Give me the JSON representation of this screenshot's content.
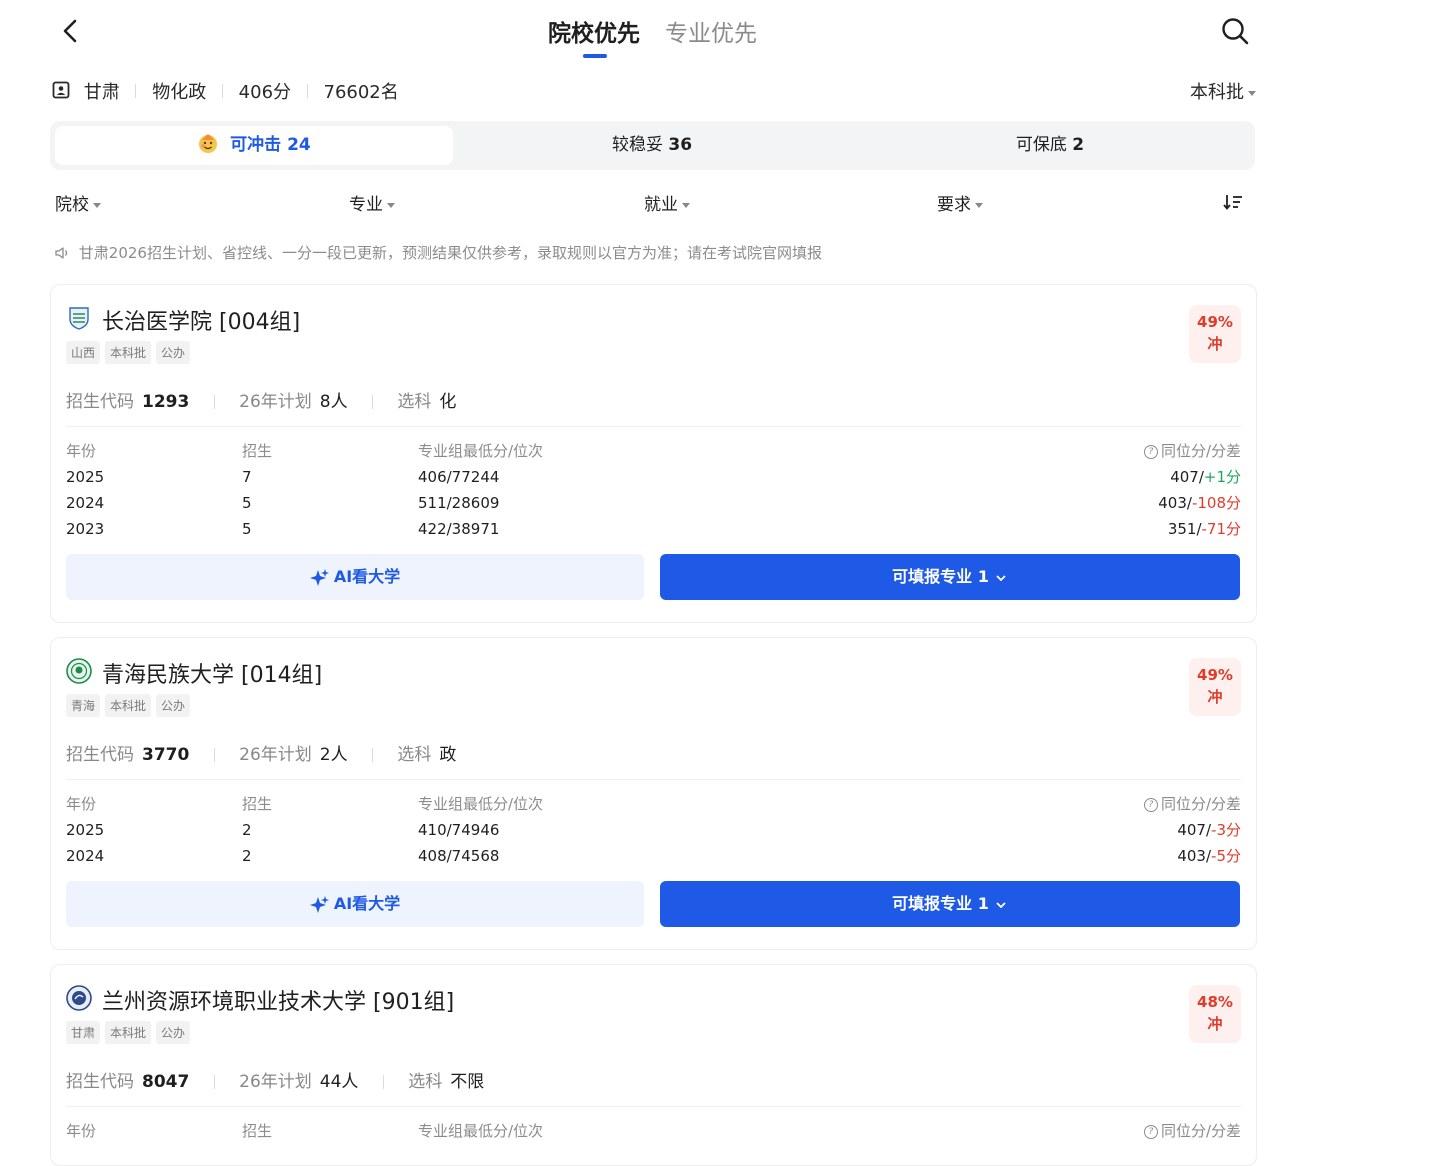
{
  "nav": {
    "tab_active": "院校优先",
    "tab_inactive": "专业优先"
  },
  "info": {
    "province": "甘肃",
    "subjects": "物化政",
    "score": "406分",
    "rank": "76602名",
    "batch": "本科批"
  },
  "segments": [
    {
      "label": "可冲击",
      "count": "24"
    },
    {
      "label": "较稳妥",
      "count": "36"
    },
    {
      "label": "可保底",
      "count": "2"
    }
  ],
  "filters": [
    "院校",
    "专业",
    "就业",
    "要求"
  ],
  "notice": "甘肃2026招生计划、省控线、一分一段已更新，预测结果仅供参考，录取规则以官方为准；请在考试院官网填报",
  "labels": {
    "code": "招生代码",
    "plan": "26年计划",
    "subject": "选科",
    "col_year": "年份",
    "col_enroll": "招生",
    "col_min": "专业组最低分/位次",
    "col_same": "同位分/分差",
    "ai_btn": "AI看大学",
    "fill_btn": "可填报专业 1"
  },
  "colors": {
    "accent": "#1e5ae6",
    "risk": "#e03c2b",
    "positive": "#1fa85b"
  },
  "cards": [
    {
      "name": "长治医学院 [004组]",
      "tags": [
        "山西",
        "本科批",
        "公办"
      ],
      "prob": "49%",
      "risk": "冲",
      "code": "1293",
      "plan": "8人",
      "subject": "化",
      "rows": [
        {
          "year": "2025",
          "enroll": "7",
          "min": "406/77244",
          "same": "407/",
          "diff": "+1分"
        },
        {
          "year": "2024",
          "enroll": "5",
          "min": "511/28609",
          "same": "403/",
          "diff": "-108分"
        },
        {
          "year": "2023",
          "enroll": "5",
          "min": "422/38971",
          "same": "351/",
          "diff": "-71分"
        }
      ]
    },
    {
      "name": "青海民族大学 [014组]",
      "tags": [
        "青海",
        "本科批",
        "公办"
      ],
      "prob": "49%",
      "risk": "冲",
      "code": "3770",
      "plan": "2人",
      "subject": "政",
      "rows": [
        {
          "year": "2025",
          "enroll": "2",
          "min": "410/74946",
          "same": "407/",
          "diff": "-3分"
        },
        {
          "year": "2024",
          "enroll": "2",
          "min": "408/74568",
          "same": "403/",
          "diff": "-5分"
        }
      ]
    },
    {
      "name": "兰州资源环境职业技术大学 [901组]",
      "tags": [
        "甘肃",
        "本科批",
        "公办"
      ],
      "prob": "48%",
      "risk": "冲",
      "code": "8047",
      "plan": "44人",
      "subject": "不限",
      "rows": []
    }
  ]
}
